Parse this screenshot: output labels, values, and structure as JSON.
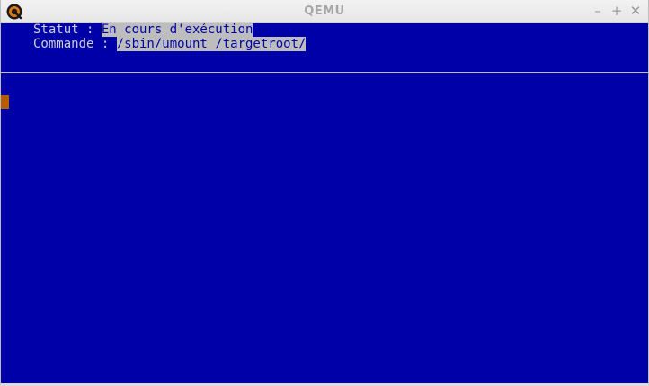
{
  "window": {
    "title": "QEMU",
    "controls": {
      "minimize": "–",
      "maximize": "+",
      "close": "✕"
    }
  },
  "status": {
    "label": "Statut : ",
    "value": "En cours d'exécution"
  },
  "command": {
    "label": "Commande : ",
    "value": "/sbin/umount /targetroot/"
  },
  "colors": {
    "background": "#0000a8",
    "text": "#d0d0d0",
    "highlight": "#bdbdbd",
    "cursor": "#b35c00"
  }
}
